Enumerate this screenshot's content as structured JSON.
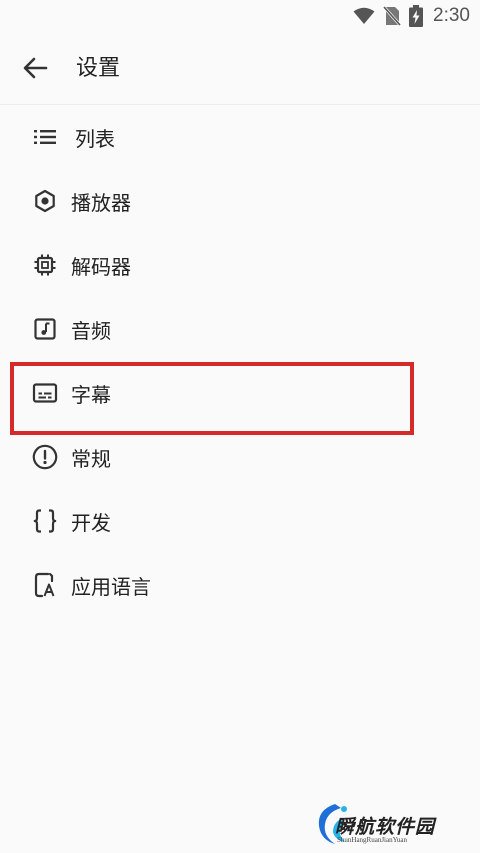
{
  "status_bar": {
    "time": "2:30",
    "icons": [
      "wifi-icon",
      "no-sim-icon",
      "battery-charging-icon"
    ]
  },
  "app_bar": {
    "title": "设置",
    "back_icon": "arrow-back-icon"
  },
  "menu": {
    "items": [
      {
        "label": "列表",
        "icon": "list-icon"
      },
      {
        "label": "播放器",
        "icon": "hexagon-dot-icon"
      },
      {
        "label": "解码器",
        "icon": "chip-icon"
      },
      {
        "label": "音频",
        "icon": "music-note-icon"
      },
      {
        "label": "字幕",
        "icon": "subtitles-icon"
      },
      {
        "label": "常规",
        "icon": "alert-circle-icon"
      },
      {
        "label": "开发",
        "icon": "code-braces-icon"
      },
      {
        "label": "应用语言",
        "icon": "phone-language-icon"
      }
    ],
    "highlighted_index": 4
  },
  "highlight": {
    "color": "#d42a2a"
  },
  "watermark": {
    "title": "瞬航软件园",
    "subtitle": "ShunHangRuanJianYuan"
  }
}
